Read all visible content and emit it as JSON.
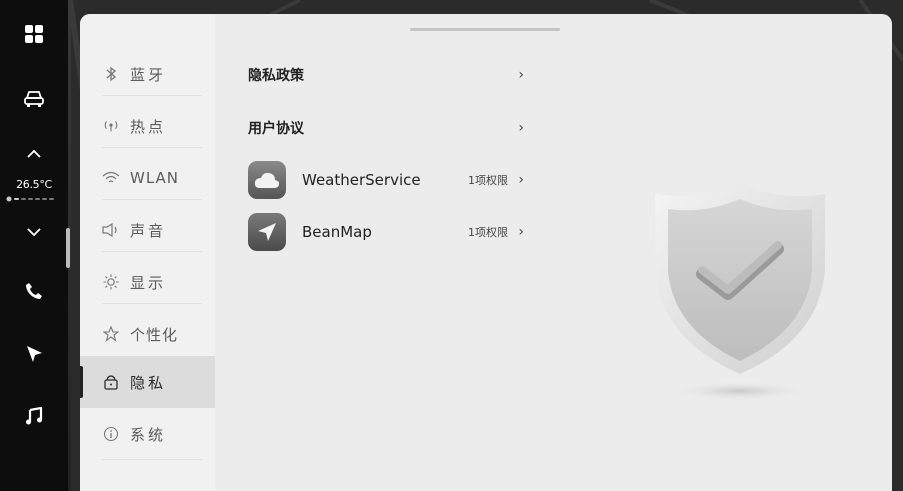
{
  "dock": {
    "temperature": "26.5°C",
    "items": [
      "apps-grid-icon",
      "car-icon",
      "chevron-up-icon",
      "chevron-down-icon",
      "phone-icon",
      "navigation-icon",
      "music-icon"
    ]
  },
  "nav": {
    "items": [
      {
        "label": "蓝牙",
        "icon": "bluetooth-icon",
        "active": false
      },
      {
        "label": "热点",
        "icon": "hotspot-icon",
        "active": false
      },
      {
        "label": "WLAN",
        "icon": "wifi-icon",
        "active": false
      },
      {
        "label": "声音",
        "icon": "speaker-icon",
        "active": false
      },
      {
        "label": "显示",
        "icon": "brightness-icon",
        "active": false
      },
      {
        "label": "个性化",
        "icon": "personalize-icon",
        "active": false
      },
      {
        "label": "隐私",
        "icon": "lock-icon",
        "active": true
      },
      {
        "label": "系统",
        "icon": "info-icon",
        "active": false
      }
    ]
  },
  "content": {
    "privacy_policy": "隐私政策",
    "user_agreement": "用户协议",
    "apps": [
      {
        "name": "WeatherService",
        "permissions": "1项权限",
        "icon": "weather-cloud-icon"
      },
      {
        "name": "BeanMap",
        "permissions": "1项权限",
        "icon": "map-arrow-icon"
      }
    ],
    "chevron": "›"
  },
  "colors": {
    "panel": "#ececec",
    "nav": "#f1f1f1",
    "active": "#dcdcdc",
    "dock": "#0d0d0d"
  }
}
